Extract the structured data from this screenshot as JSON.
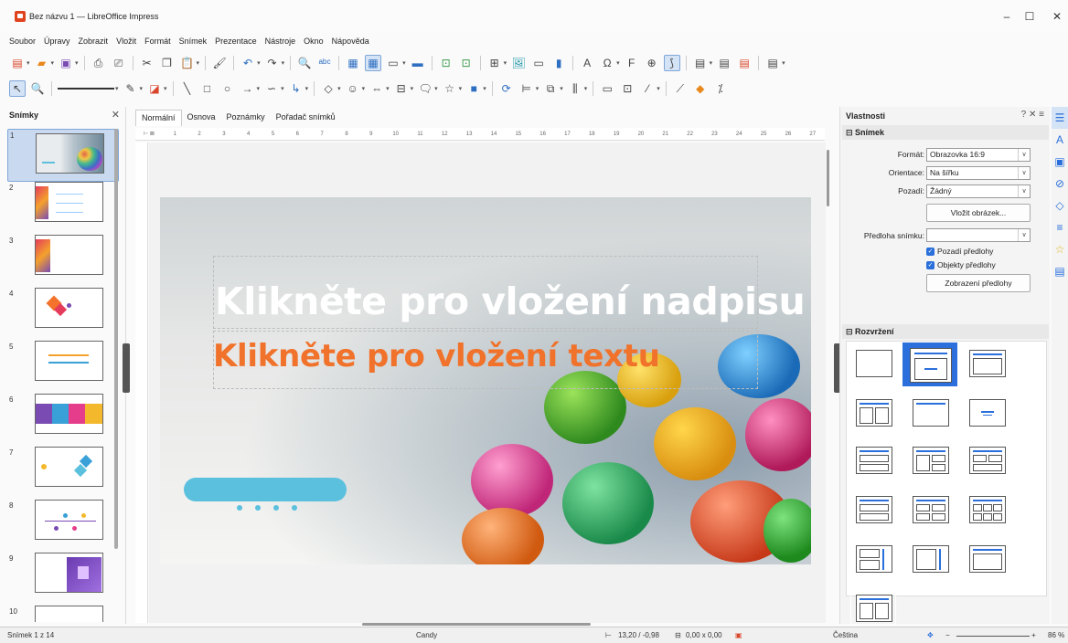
{
  "window": {
    "title": "Bez názvu 1 — LibreOffice Impress",
    "min": "–",
    "max": "☐",
    "close": "✕"
  },
  "menu": [
    "Soubor",
    "Úpravy",
    "Zobrazit",
    "Vložit",
    "Formát",
    "Snímek",
    "Prezentace",
    "Nástroje",
    "Okno",
    "Nápověda"
  ],
  "slides_pane": {
    "title": "Snímky",
    "close": "✕",
    "numbers": [
      "1",
      "2",
      "3",
      "4",
      "5",
      "6",
      "7",
      "8",
      "9",
      "10"
    ]
  },
  "view_tabs": [
    "Normální",
    "Osnova",
    "Poznámky",
    "Pořadač snímků"
  ],
  "ruler_ticks": [
    "1",
    "2",
    "3",
    "4",
    "5",
    "6",
    "7",
    "8",
    "9",
    "10",
    "11",
    "12",
    "13",
    "14",
    "15",
    "16",
    "17",
    "18",
    "19",
    "20",
    "21",
    "22",
    "23",
    "24",
    "25",
    "26",
    "27",
    "28"
  ],
  "slide": {
    "title_placeholder": "Klikněte pro vložení nadpisu",
    "text_placeholder": "Klikněte pro vložení textu"
  },
  "properties": {
    "title": "Vlastnosti",
    "controls": "? ✕ ≡",
    "section_slide": "Snímek",
    "format_label": "Formát:",
    "format_value": "Obrazovka 16:9",
    "orientation_label": "Orientace:",
    "orientation_value": "Na šířku",
    "background_label": "Pozadí:",
    "background_value": "Žádný",
    "insert_image": "Vložit obrázek...",
    "master_label": "Předloha snímku:",
    "master_value": "",
    "master_background": "Pozadí předlohy",
    "master_objects": "Objekty předlohy",
    "master_view": "Zobrazení předlohy",
    "section_layout": "Rozvržení"
  },
  "status": {
    "slide_pos": "Snímek 1 z 14",
    "master": "Candy",
    "position": "13,20 / -0,98",
    "size": "0,00 x 0,00",
    "language": "Čeština",
    "zoom": "86 %"
  },
  "colors": {
    "accent_blue": "#2a6fdb",
    "title_orange": "#f0722b",
    "pill_blue": "#5bc0de"
  }
}
